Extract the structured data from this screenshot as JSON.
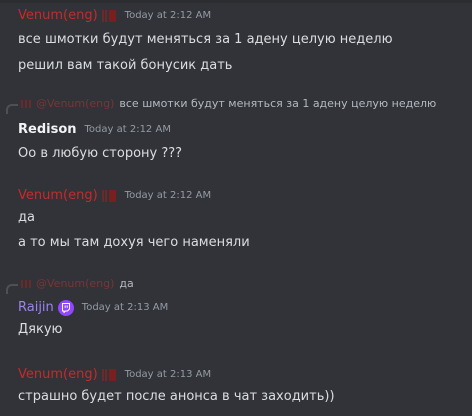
{
  "messages": [
    {
      "username": "Venum(eng)",
      "timestamp": "Today at 2:12 AM",
      "lines": [
        "все шмотки будут меняться за 1 адену целую неделю",
        "решил вам такой бонусик дать"
      ]
    },
    {
      "reply_mention": "@Venum(eng)",
      "reply_text": "все шмотки будут меняться за 1 адену целую неделю",
      "username": "Redison",
      "timestamp": "Today at 2:12 AM",
      "lines": [
        "Оо в любую сторону ???"
      ]
    },
    {
      "username": "Venum(eng)",
      "timestamp": "Today at 2:12 AM",
      "lines": [
        "да",
        "а то мы там дохуя чего наменяли"
      ]
    },
    {
      "reply_mention": "@Venum(eng)",
      "reply_text": "да",
      "username": "Raijin",
      "timestamp": "Today at 2:13 AM",
      "lines": [
        "Дякую"
      ]
    },
    {
      "username": "Venum(eng)",
      "timestamp": "Today at 2:13 AM",
      "lines": [
        "страшно будет после анонса в чат заходить))"
      ]
    }
  ],
  "colors": {
    "background": "#313338",
    "text": "#dbdee1",
    "timestamp": "#949ba4",
    "venum_name": "#c72a2a",
    "redison_name": "#f2f3f5",
    "raijin_name": "#9b84ee",
    "twitch_badge": "#9146ff"
  },
  "icons": {
    "venum_badge": "role-badge-icon",
    "raijin_badge": "twitch-icon",
    "reply_avatar": "avatar-icon"
  }
}
